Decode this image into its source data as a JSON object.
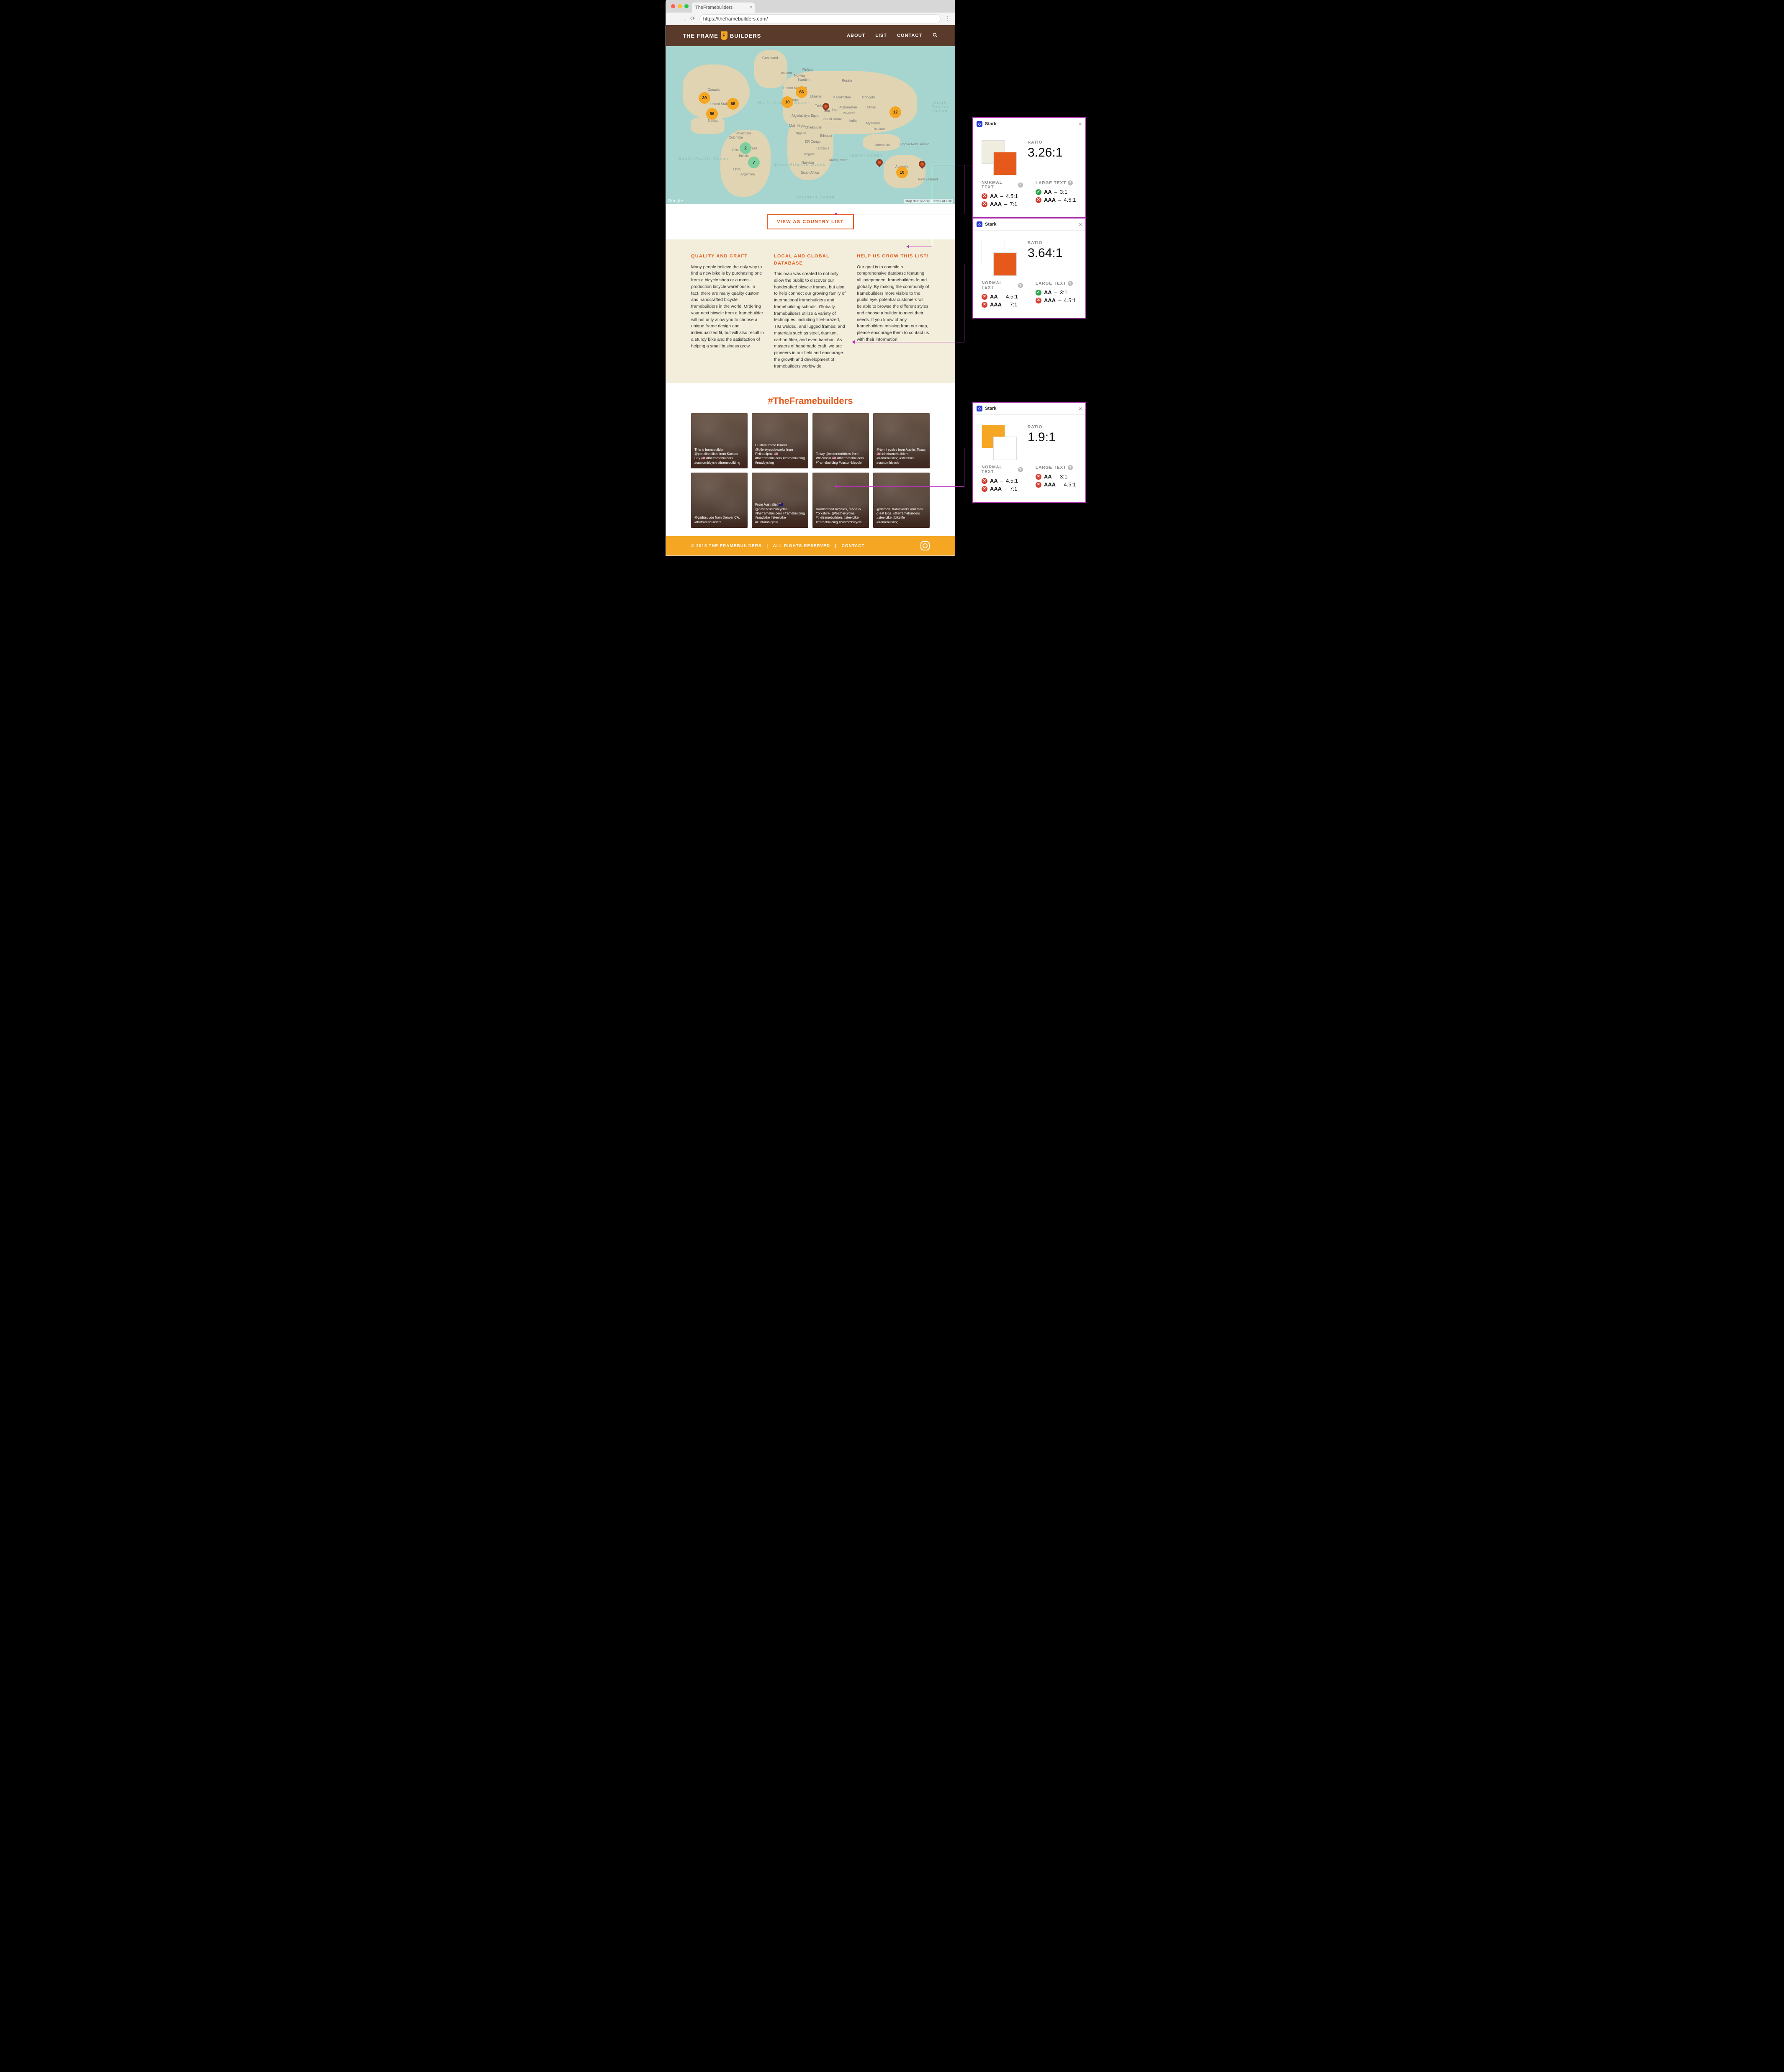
{
  "browser": {
    "tab_title": "TheFramebuilders",
    "url": "https://theframebuilders.com/"
  },
  "header": {
    "brand_left": "THE FRAME",
    "brand_right": "BUILDERS",
    "nav": {
      "about": "ABOUT",
      "list": "LIST",
      "contact": "CONTACT"
    }
  },
  "map": {
    "clusters": {
      "na1": "39",
      "na2": "68",
      "na3": "56",
      "eu1": "66",
      "eu2": "10",
      "sa1": "2",
      "sa2": "7",
      "asia1": "12",
      "au1": "10"
    },
    "labels": {
      "greenland": "Greenland",
      "iceland": "Iceland",
      "finland": "Finland",
      "norway": "Norway",
      "sweden": "Sweden",
      "russia": "Russia",
      "uk": "United Kingdom",
      "ukraine": "Ukraine",
      "kazakhstan": "Kazakhstan",
      "mongolia": "Mongolia",
      "france": "France",
      "turkey": "Turkey",
      "iraq": "Iraq",
      "iran": "Iran",
      "afghanistan": "Afghanistan",
      "pakistan": "Pakistan",
      "china": "China",
      "algeria": "Algeria",
      "libya": "Libya",
      "egypt": "Egypt",
      "saudi": "Saudi Arabia",
      "canada": "Canada",
      "us": "United States",
      "mexico": "Mexico",
      "venezuela": "Venezuela",
      "colombia": "Colombia",
      "brazil": "Brazil",
      "bolivia": "Bolivia",
      "peru": "Peru",
      "chile": "Chile",
      "argentina": "Argentina",
      "mali": "Mali",
      "niger": "Niger",
      "chad": "Chad",
      "sudan": "Sudan",
      "nigeria": "Nigeria",
      "ethiopia": "Ethiopia",
      "drc": "DR Congo",
      "tanzania": "Tanzania",
      "angola": "Angola",
      "namibia": "Namibia",
      "madagascar": "Madagascar",
      "southafrica": "South Africa",
      "india": "India",
      "myanmar": "Myanmar",
      "thailand": "Thailand",
      "indonesia": "Indonesia",
      "png": "Papua New Guinea",
      "australia": "Australia",
      "newzealand": "New Zealand"
    },
    "oceans": {
      "npac": "North\nPacific\nOcean",
      "spac": "South\nPacific\nOcean",
      "natl": "North\nAtlantic\nOcean",
      "satl": "South\nAtlantic\nOcean",
      "ind": "Indian\nOcean",
      "southern": "Southern\nOcean"
    },
    "google": "Google",
    "attribution": "Map data ©2018",
    "terms": "Terms of Use"
  },
  "cta": {
    "label": "VIEW AS COUNTRY LIST"
  },
  "columns": {
    "c1": {
      "title": "QUALITY AND CRAFT",
      "body": "Many people believe the only way to find a new bike is by purchasing one from a bicycle shop or a mass-production bicycle warehouse. In fact, there are many quality custom and handcrafted bicycle framebuilders in the world. Ordering your next bicycle from a framebuilder will not only allow you to choose a unique frame design and individualized fit, but will also result in a sturdy bike and the satisfaction of helping a small business grow."
    },
    "c2": {
      "title": "LOCAL AND GLOBAL DATABASE",
      "body": "This map was created to not only allow the public to discover our handcrafted bicycle frames, but also to help connect our growing family of international framebuilders and framebuilding schools. Globally, framebuilders utilize a variety of techniques, including fillet-brazed, TIG welded, and lugged frames; and materials such as steel, titanium, carbon fiber, and even bamboo. As masters of handmade craft, we are pioneers in our field and encourage the growth and development of framebuilders worldwide."
    },
    "c3": {
      "title": "HELP US GROW THIS LIST!",
      "body": "Our goal is to compile a comprehensive database featuring all independent framebuilders found globally. By making the community of framebuilders more visible to the public eye, potential customers will be able to browse the different styles and choose a builder to meet their needs. If you know of any framebuilders missing from our map, please encourage them to contact us with their information!"
    }
  },
  "hashtag": "#TheFramebuilders",
  "cards": {
    "c1": "This is framebuilder @pedalinobikes from Kansas City 🇺🇸 #theframebuilders #custombicycle #framebuilding",
    "c2": "Custom frame builder @bilenkycycleworks from Philadelphia 🇺🇸 #theframebuilders #framebuilding #roadcycling",
    "c3": "Today @waterfordbikes from Wisconsin 🇺🇸 #theframebuilders #framebuilding #custombicycle",
    "c4": "@tomii cycles from Austin, Texas 🇺🇸 #theframebuilders #framebuilding #steelbike #custombicycle",
    "c5": "@gallusdude  from Denver CA. #theframebuilders",
    "c6": "From Australia! 🇦🇺 @devlincustomcycles #theframebuilders #framebuilding #roadbike #steelbike #custombicycle",
    "c7": "Handcrafted bicycles, made in Yorkshire. @feathercycles #theframebuilders #steelbike #framebuilding #custombicycle",
    "c8": "@demon_frameworks and their great lugs. #theframebuilders #steelbike #bikelife #framebuilding"
  },
  "footer": {
    "copyright": "© 2018 THE FRAMEBUILDERS",
    "rights": "ALL RIGHTS RESERVED",
    "contact": "CONTACT"
  },
  "stark": {
    "title": "Stark",
    "ratio_label": "RATIO",
    "normal_text": "NORMAL TEXT",
    "large_text": "LARGE TEXT",
    "aa": "AA",
    "aaa": "AAA",
    "r45": "4.5:1",
    "r7": "7:1",
    "r3": "3:1",
    "panel1": {
      "ratio": "3.26:1",
      "swatch_a": "#efece0",
      "swatch_b": "#e55a1b",
      "normal_aa": "fail",
      "normal_aaa": "fail",
      "large_aa": "pass",
      "large_aaa": "fail"
    },
    "panel2": {
      "ratio": "3.64:1",
      "swatch_a": "#ffffff",
      "swatch_b": "#e55a1b",
      "normal_aa": "fail",
      "normal_aaa": "fail",
      "large_aa": "pass",
      "large_aaa": "fail"
    },
    "panel3": {
      "ratio": "1.9:1",
      "swatch_a": "#f5a623",
      "swatch_b": "#ffffff",
      "normal_aa": "fail",
      "normal_aaa": "fail",
      "large_aa": "fail",
      "large_aaa": "fail"
    }
  }
}
